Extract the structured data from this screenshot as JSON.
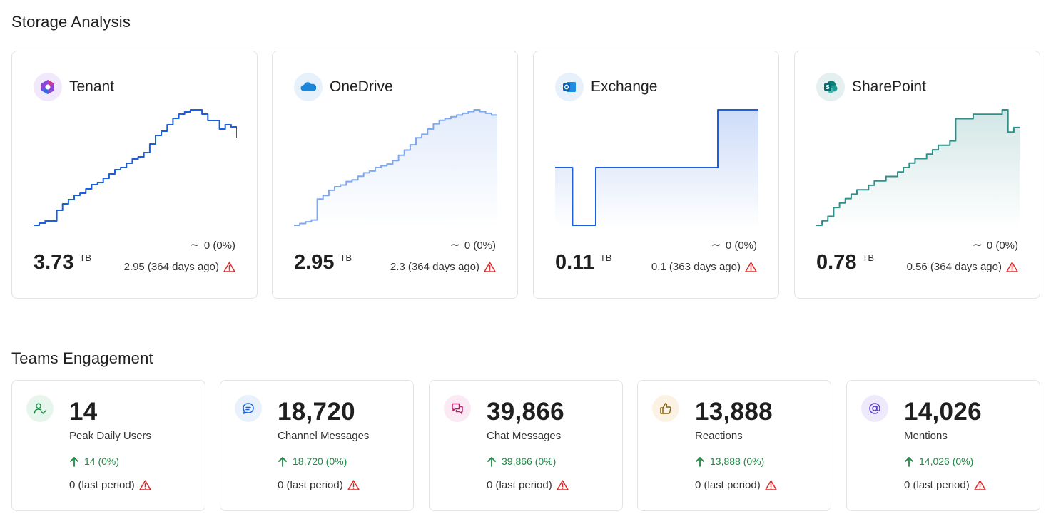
{
  "storage": {
    "title": "Storage Analysis",
    "cards": [
      {
        "name": "Tenant",
        "icon": "microsoft365-icon",
        "trend": "0 (0%)",
        "value": "3.73",
        "unit": "TB",
        "previous": "2.95 (364 days ago)",
        "line_color": "#1a5fe0",
        "fill": false,
        "chart_data": {
          "type": "line",
          "y": [
            2.95,
            2.96,
            2.97,
            2.97,
            3.02,
            3.05,
            3.07,
            3.09,
            3.1,
            3.12,
            3.14,
            3.15,
            3.17,
            3.19,
            3.21,
            3.22,
            3.24,
            3.26,
            3.27,
            3.29,
            3.33,
            3.37,
            3.39,
            3.42,
            3.45,
            3.47,
            3.48,
            3.49,
            3.49,
            3.47,
            3.44,
            3.44,
            3.4,
            3.42,
            3.41,
            3.36
          ]
        }
      },
      {
        "name": "OneDrive",
        "icon": "onedrive-icon",
        "trend": "0 (0%)",
        "value": "2.95",
        "unit": "TB",
        "previous": "2.3 (364 days ago)",
        "line_color": "#7ea7ee",
        "fill": true,
        "chart_data": {
          "type": "area",
          "y": [
            2.3,
            2.31,
            2.32,
            2.33,
            2.45,
            2.47,
            2.5,
            2.52,
            2.53,
            2.55,
            2.56,
            2.58,
            2.6,
            2.61,
            2.63,
            2.64,
            2.65,
            2.67,
            2.7,
            2.73,
            2.76,
            2.8,
            2.82,
            2.85,
            2.88,
            2.9,
            2.91,
            2.92,
            2.93,
            2.94,
            2.95,
            2.96,
            2.95,
            2.94,
            2.93,
            2.93
          ]
        }
      },
      {
        "name": "Exchange",
        "icon": "outlook-icon",
        "trend": "0 (0%)",
        "value": "0.11",
        "unit": "TB",
        "previous": "0.1 (363 days ago)",
        "line_color": "#1a5fe0",
        "fill": true,
        "chart_data": {
          "type": "area",
          "y": [
            0.105,
            0.105,
            0.105,
            0.1,
            0.1,
            0.1,
            0.1,
            0.105,
            0.105,
            0.105,
            0.105,
            0.105,
            0.105,
            0.105,
            0.105,
            0.105,
            0.105,
            0.105,
            0.105,
            0.105,
            0.105,
            0.105,
            0.105,
            0.105,
            0.105,
            0.105,
            0.105,
            0.105,
            0.11,
            0.11,
            0.11,
            0.11,
            0.11,
            0.11,
            0.11,
            0.11
          ]
        }
      },
      {
        "name": "SharePoint",
        "icon": "sharepoint-icon",
        "trend": "0 (0%)",
        "value": "0.78",
        "unit": "TB",
        "previous": "0.56 (364 days ago)",
        "line_color": "#2f8f8a",
        "fill": true,
        "chart_data": {
          "type": "area",
          "y": [
            0.56,
            0.57,
            0.58,
            0.6,
            0.61,
            0.62,
            0.63,
            0.64,
            0.64,
            0.65,
            0.66,
            0.66,
            0.67,
            0.67,
            0.68,
            0.69,
            0.7,
            0.71,
            0.71,
            0.72,
            0.73,
            0.74,
            0.74,
            0.75,
            0.8,
            0.8,
            0.8,
            0.81,
            0.81,
            0.81,
            0.81,
            0.81,
            0.82,
            0.77,
            0.78,
            0.78
          ]
        }
      }
    ]
  },
  "teams": {
    "title": "Teams Engagement",
    "cards": [
      {
        "icon": "user-check-icon",
        "value": "14",
        "label": "Peak Daily Users",
        "change": "14 (0%)",
        "previous": "0 (last period)"
      },
      {
        "icon": "channel-message-icon",
        "value": "18,720",
        "label": "Channel Messages",
        "change": "18,720 (0%)",
        "previous": "0 (last period)"
      },
      {
        "icon": "chat-icon",
        "value": "39,866",
        "label": "Chat Messages",
        "change": "39,866 (0%)",
        "previous": "0 (last period)"
      },
      {
        "icon": "thumbs-up-icon",
        "value": "13,888",
        "label": "Reactions",
        "change": "13,888 (0%)",
        "previous": "0 (last period)"
      },
      {
        "icon": "at-sign-icon",
        "value": "14,026",
        "label": "Mentions",
        "change": "14,026 (0%)",
        "previous": "0 (last period)"
      }
    ]
  }
}
